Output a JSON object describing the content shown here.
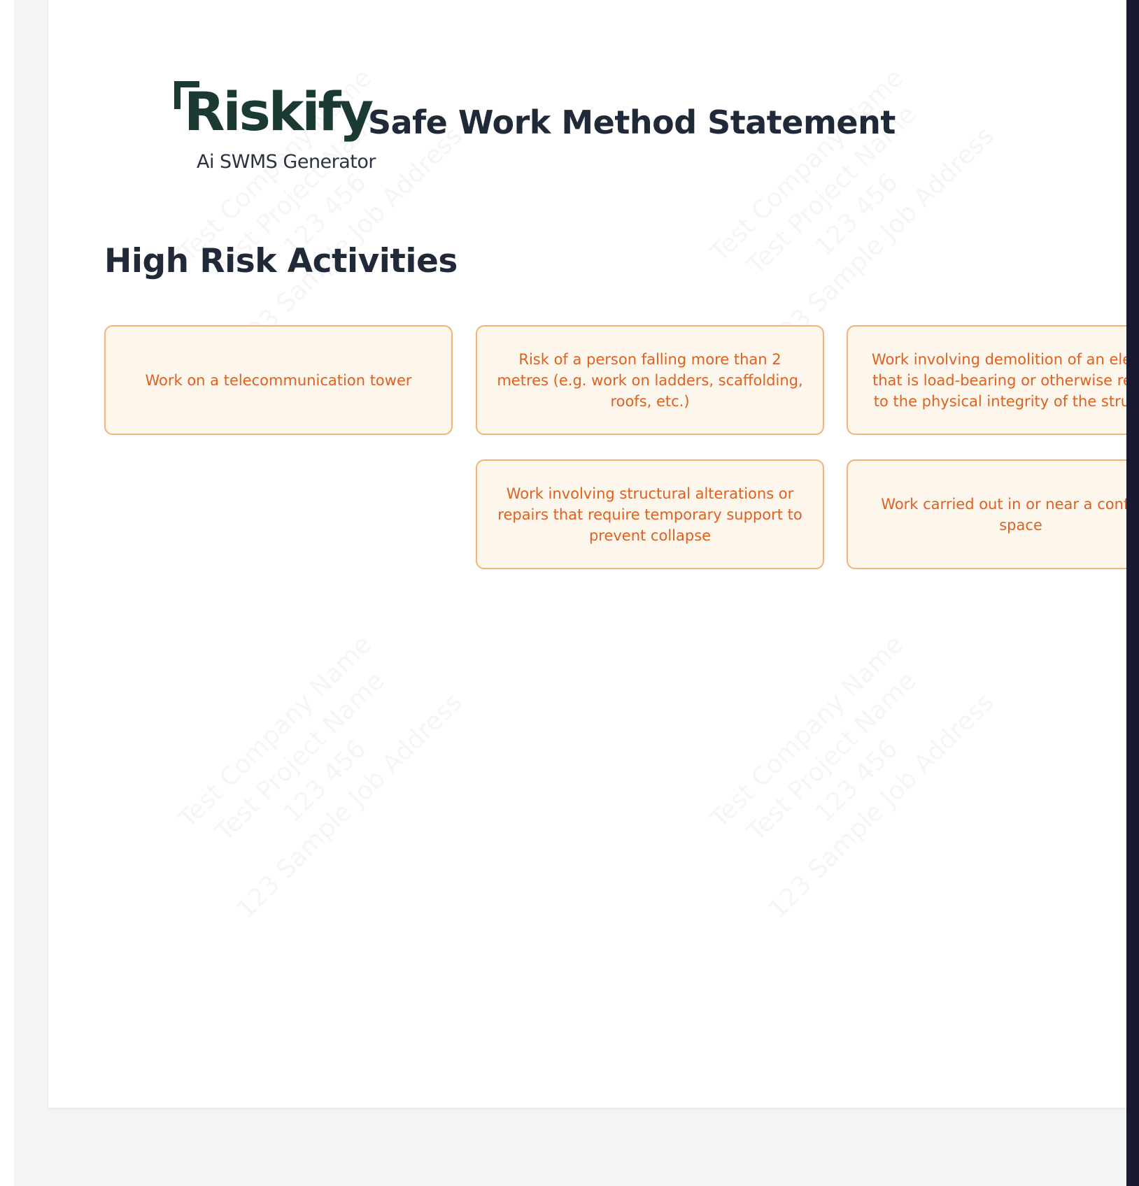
{
  "logo": {
    "name": "Riskify",
    "tagline": "Ai SWMS Generator"
  },
  "document": {
    "title": "Safe Work Method Statement"
  },
  "section": {
    "title": "High Risk Activities"
  },
  "activities": [
    "Work on a telecommunication tower",
    "Risk of a person falling more than 2 metres (e.g. work on ladders, scaffolding, roofs, etc.)",
    "Work involving demolition of an element that is load-bearing or otherwise related to the physical integrity of the structure",
    "Work involving structural alterations or repairs that require temporary support to prevent collapse",
    "Work carried out in or near a confined space"
  ],
  "watermark": {
    "lines": [
      "Test Company Name",
      "Test Project Name",
      "123 456",
      "123 Sample Job Address"
    ]
  },
  "colors": {
    "card_border": "#f6b173",
    "card_background": "#fdf6ec",
    "card_text": "#de6120",
    "heading_text": "#1f2937",
    "logo_green": "#1c3a34"
  }
}
